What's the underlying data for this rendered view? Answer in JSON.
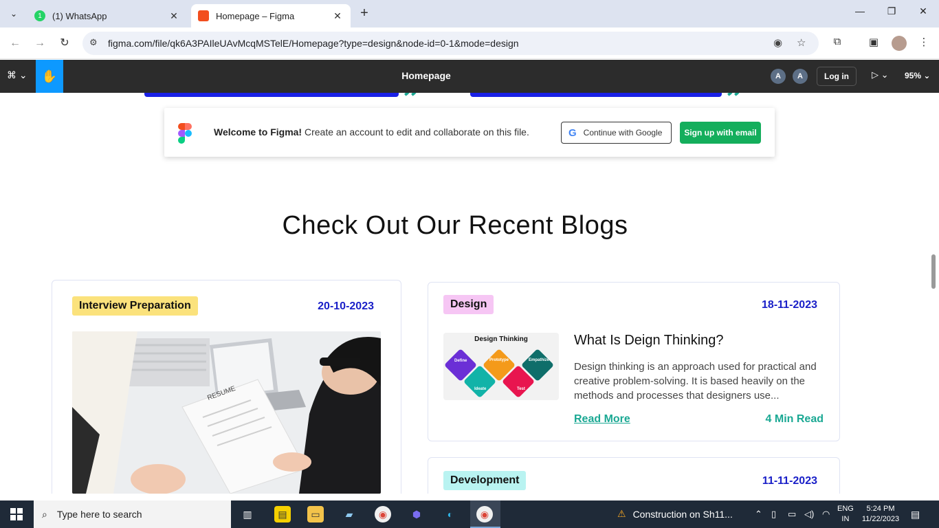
{
  "browser": {
    "tabs": [
      {
        "title": "(1) WhatsApp",
        "favicon": "whatsapp-icon",
        "color": "#25d366"
      },
      {
        "title": "Homepage – Figma",
        "favicon": "figma-icon",
        "active": true
      }
    ],
    "url": "figma.com/file/qk6A3PAIleUAvMcqMSTelE/Homepage?type=design&node-id=0-1&mode=design"
  },
  "figma": {
    "title": "Homepage",
    "avatars": [
      "A",
      "A"
    ],
    "login_label": "Log in",
    "zoom": "95%"
  },
  "welcome": {
    "bold": "Welcome to Figma!",
    "text": " Create an account to edit and collaborate on this file.",
    "google_label": "Continue with Google",
    "email_label": "Sign up with email"
  },
  "page": {
    "heading": "Check Out Our Recent Blogs",
    "cards": [
      {
        "tag": "Interview Preparation",
        "tag_color": "#fbe27c",
        "date": "20-10-2023",
        "photo_text": "RESUME"
      },
      {
        "tag": "Design",
        "tag_color": "#f6c6f4",
        "date": "18-11-2023",
        "image_title": "Design Thinking",
        "diagram_labels": [
          "Define",
          "Prototype",
          "Empathize",
          "Ideate",
          "Test"
        ],
        "title": "What Is Deign Thinking?",
        "desc": "Design thinking is an approach used for practical and creative problem-solving. It is based heavily on the methods and processes that designers use...",
        "read_more": "Read More",
        "read_time": "4 Min Read"
      },
      {
        "tag": "Development",
        "tag_color": "#b9f3f1",
        "date": "11-11-2023"
      }
    ]
  },
  "taskbar": {
    "search_placeholder": "Type here to search",
    "notification": "Construction on Sh11...",
    "lang": "ENG",
    "region": "IN",
    "time": "5:24 PM",
    "date": "11/22/2023"
  }
}
